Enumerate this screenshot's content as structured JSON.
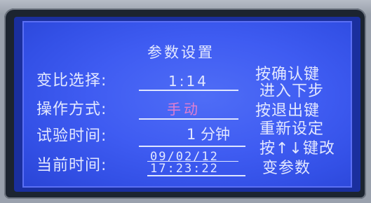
{
  "screen": {
    "title": "参数设置",
    "fields": [
      {
        "label": "变比选择:",
        "value": "1:14"
      },
      {
        "label": "操作方式:",
        "value": "手动"
      },
      {
        "label": "试验时间:",
        "value": "1 分钟"
      },
      {
        "label": "当前时间:",
        "date": "09/02/12",
        "time": "17:23:22"
      }
    ],
    "instructions": [
      "按确认键",
      "进入下步",
      "按退出键",
      "重新设定",
      "按↑↓键改",
      "变参数"
    ]
  },
  "colors": {
    "screen_bg": "#4262f2",
    "text": "#e3e8ff",
    "mode_value": "#e07fd0",
    "bezel": "#1c2430"
  }
}
